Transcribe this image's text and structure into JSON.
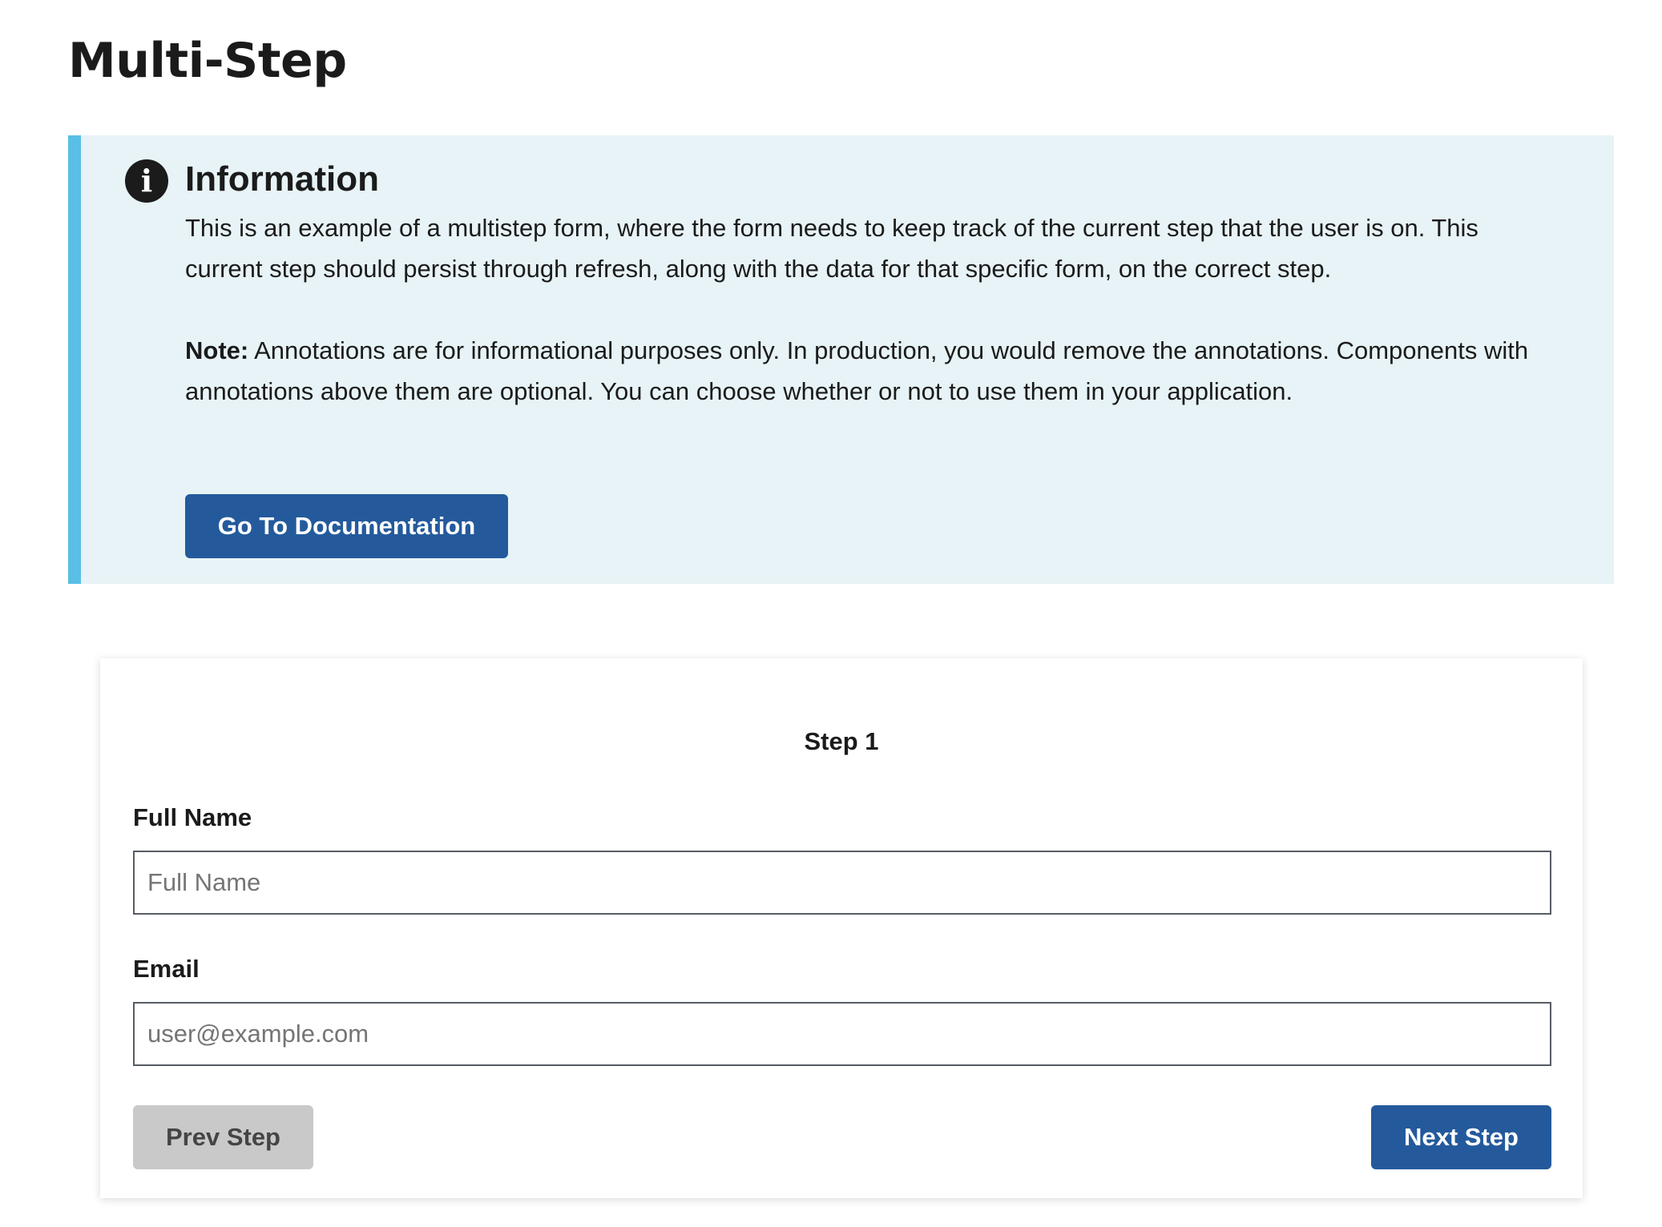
{
  "page": {
    "title": "Multi-Step"
  },
  "alert": {
    "icon": "info-icon",
    "icon_glyph": "i",
    "heading": "Information",
    "body": "This is an example of a multistep form, where the form needs to keep track of the current step that the user is on. This current step should persist through refresh, along with the data for that specific form, on the correct step.",
    "note_label": "Note:",
    "note_text": " Annotations are for informational purposes only. In production, you would remove the annotations. Components with annotations above them are optional. You can choose whether or not to use them in your application.",
    "button_label": "Go To Documentation",
    "accent_color": "#59bfe5",
    "background_color": "#e7f3f6"
  },
  "form": {
    "step_title": "Step 1",
    "full_name": {
      "label": "Full Name",
      "placeholder": "Full Name",
      "value": ""
    },
    "email": {
      "label": "Email",
      "placeholder": "user@example.com",
      "value": ""
    },
    "prev_label": "Prev Step",
    "next_label": "Next Step",
    "primary_color": "#245a9c",
    "disabled_color": "#c9c9c9"
  }
}
